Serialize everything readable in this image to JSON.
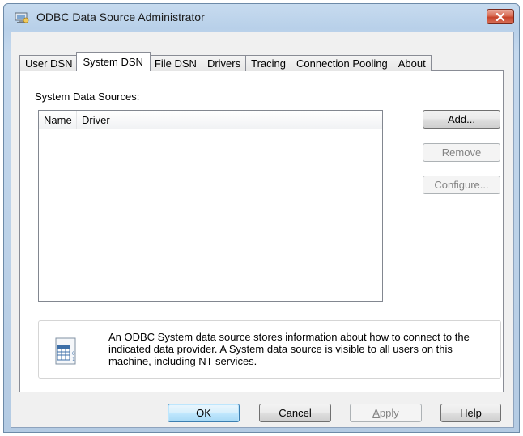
{
  "window": {
    "title": "ODBC Data Source Administrator",
    "icon": "odbc-app-icon",
    "close_icon": "close-x-icon"
  },
  "tabs": [
    {
      "label": "User DSN",
      "active": false
    },
    {
      "label": "System DSN",
      "active": true
    },
    {
      "label": "File DSN",
      "active": false
    },
    {
      "label": "Drivers",
      "active": false
    },
    {
      "label": "Tracing",
      "active": false
    },
    {
      "label": "Connection Pooling",
      "active": false
    },
    {
      "label": "About",
      "active": false
    }
  ],
  "panel": {
    "section_label": "System Data Sources:",
    "columns": [
      "Name",
      "Driver"
    ],
    "rows": []
  },
  "side_buttons": {
    "add": "Add...",
    "remove": "Remove",
    "configure": "Configure..."
  },
  "info": {
    "icon": "data-source-icon",
    "text": "An ODBC System data source stores information about how to connect to the indicated data provider.   A System data source is visible to all users on this machine, including NT services."
  },
  "footer": {
    "ok": "OK",
    "cancel": "Cancel",
    "apply_accel": "A",
    "apply_rest": "pply",
    "help": "Help"
  },
  "colors": {
    "title_bar": "#c7dbef",
    "close_button": "#c6432a",
    "default_button_border": "#3c7fb1",
    "disabled_text": "#838383"
  }
}
